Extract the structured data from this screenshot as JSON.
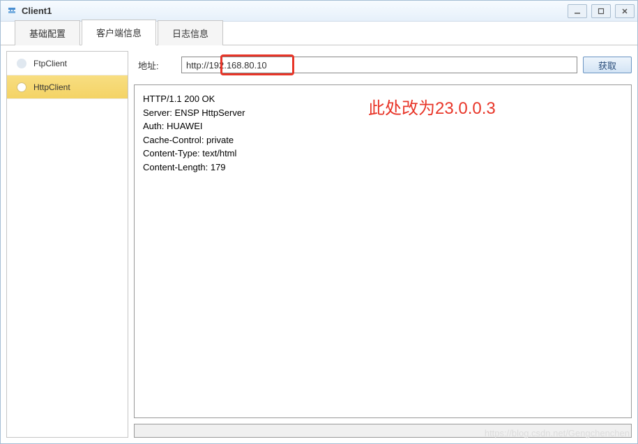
{
  "window": {
    "title": "Client1"
  },
  "tabs": [
    {
      "label": "基础配置"
    },
    {
      "label": "客户端信息"
    },
    {
      "label": "日志信息"
    }
  ],
  "sidebar": {
    "items": [
      {
        "label": "FtpClient"
      },
      {
        "label": "HttpClient"
      }
    ]
  },
  "main": {
    "address_label": "地址:",
    "address_value": "http://192.168.80.10",
    "fetch_button": "获取",
    "response_text": "HTTP/1.1 200 OK\nServer: ENSP HttpServer\nAuth: HUAWEI\nCache-Control: private\nContent-Type: text/html\nContent-Length: 179"
  },
  "annotation": {
    "text": "此处改为23.0.0.3"
  },
  "watermark": "https://blog.csdn.net/Gengchenchen"
}
